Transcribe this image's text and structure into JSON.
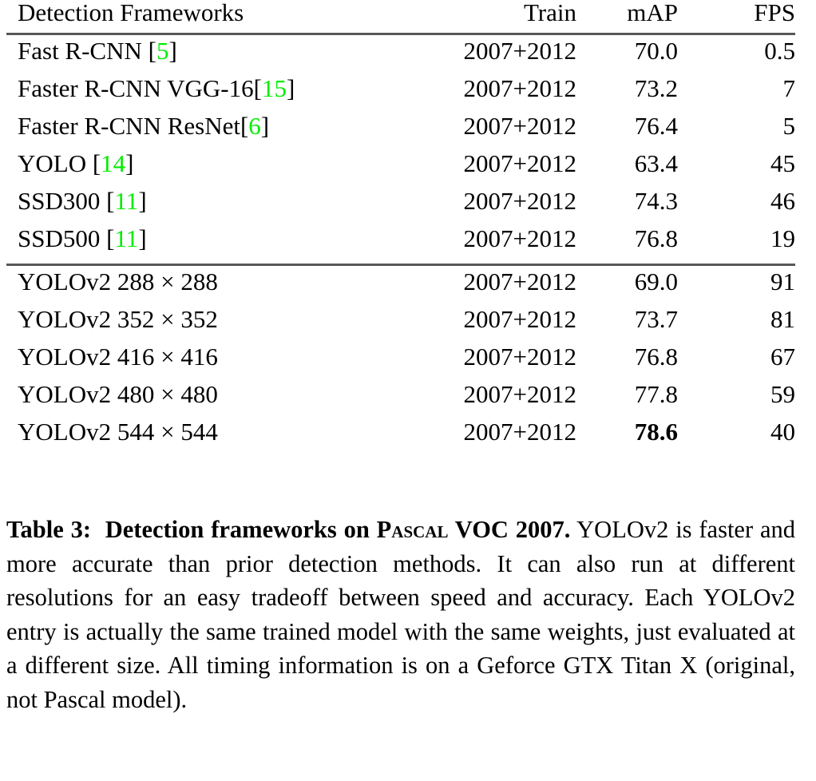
{
  "table": {
    "columns": [
      "Detection Frameworks",
      "Train",
      "mAP",
      "FPS"
    ],
    "rows_group_1": [
      {
        "name_pre": "Fast R-CNN [",
        "cite": "5",
        "name_post": "]",
        "train": "2007+2012",
        "map": "70.0",
        "fps": "0.5",
        "map_bold": false
      },
      {
        "name_pre": "Faster R-CNN VGG-16[",
        "cite": "15",
        "name_post": "]",
        "train": "2007+2012",
        "map": "73.2",
        "fps": "7",
        "map_bold": false
      },
      {
        "name_pre": "Faster R-CNN ResNet[",
        "cite": "6",
        "name_post": "]",
        "train": "2007+2012",
        "map": "76.4",
        "fps": "5",
        "map_bold": false
      },
      {
        "name_pre": "YOLO [",
        "cite": "14",
        "name_post": "]",
        "train": "2007+2012",
        "map": "63.4",
        "fps": "45",
        "map_bold": false
      },
      {
        "name_pre": "SSD300 [",
        "cite": "11",
        "name_post": "]",
        "train": "2007+2012",
        "map": "74.3",
        "fps": "46",
        "map_bold": false
      },
      {
        "name_pre": "SSD500 [",
        "cite": "11",
        "name_post": "]",
        "train": "2007+2012",
        "map": "76.8",
        "fps": "19",
        "map_bold": false
      }
    ],
    "rows_group_2": [
      {
        "name": "YOLOv2 288 × 288",
        "train": "2007+2012",
        "map": "69.0",
        "fps": "91",
        "map_bold": false
      },
      {
        "name": "YOLOv2 352 × 352",
        "train": "2007+2012",
        "map": "73.7",
        "fps": "81",
        "map_bold": false
      },
      {
        "name": "YOLOv2 416 × 416",
        "train": "2007+2012",
        "map": "76.8",
        "fps": "67",
        "map_bold": false
      },
      {
        "name": "YOLOv2 480 × 480",
        "train": "2007+2012",
        "map": "77.8",
        "fps": "59",
        "map_bold": false
      },
      {
        "name": "YOLOv2 544 × 544",
        "train": "2007+2012",
        "map": "78.6",
        "fps": "40",
        "map_bold": true
      }
    ]
  },
  "caption": {
    "label": "Table 3:",
    "title_pre": "Detection frameworks on ",
    "title_smallcaps": "Pascal",
    "title_post": " VOC 2007.",
    "body": "YOLOv2 is faster and more accurate than prior detection methods. It can also run at different resolutions for an easy tradeoff between speed and accuracy. Each YOLOv2 entry is actually the same trained model with the same weights, just evaluated at a different size. All timing information is on a Geforce GTX Titan X (original, not Pascal model)."
  },
  "colors": {
    "citation_green": "#00ee00",
    "rule_gray": "#58585a",
    "text": "#000000",
    "background": "#ffffff"
  }
}
